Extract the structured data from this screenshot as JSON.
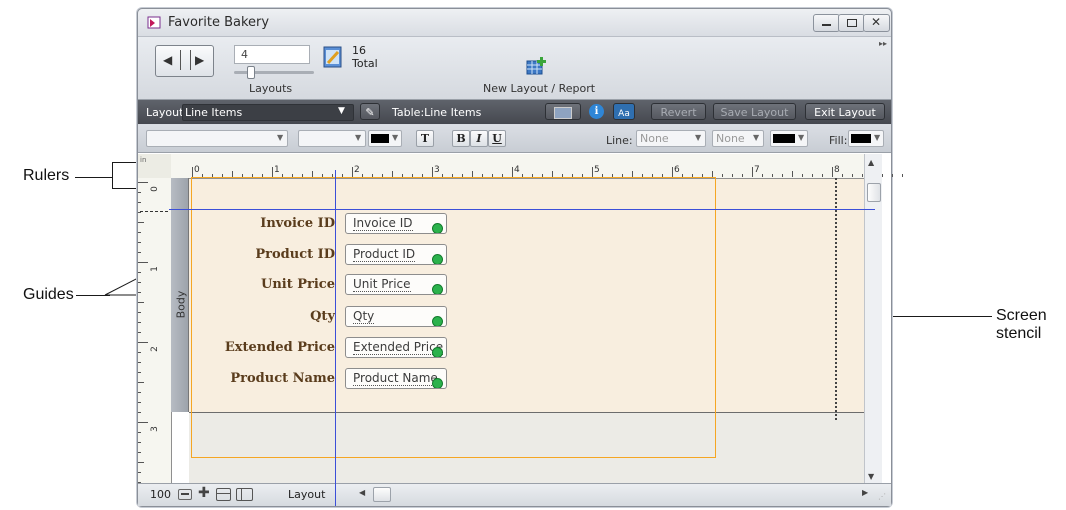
{
  "window": {
    "title": "Favorite Bakery"
  },
  "toolbar": {
    "record_value": "4",
    "layouts_label": "Layouts",
    "total_count": "16",
    "total_label": "Total",
    "new_layout_label": "New Layout / Report"
  },
  "layout_bar": {
    "layout_prefix": "Layout:",
    "layout_name": "Line Items",
    "table_text": "Table:Line Items",
    "revert": "Revert",
    "save_layout": "Save Layout",
    "exit_layout": "Exit Layout",
    "aa": "Aa",
    "info": "i"
  },
  "format_bar": {
    "text_btn": "T",
    "bold": "B",
    "italic": "I",
    "underline": "U",
    "line_label": "Line:",
    "line_value": "None",
    "line_value2": "None",
    "fill_label": "Fill:"
  },
  "ruler": {
    "h_ticks": [
      "0",
      "1",
      "2",
      "3",
      "4",
      "5",
      "6",
      "7",
      "8"
    ],
    "v_ticks": [
      "0",
      "1",
      "2",
      "3"
    ],
    "unit": "in"
  },
  "part_label": "Body",
  "fields": [
    {
      "label": "Invoice ID",
      "field": "Invoice ID"
    },
    {
      "label": "Product ID",
      "field": "Product ID"
    },
    {
      "label": "Unit Price",
      "field": "Unit Price"
    },
    {
      "label": "Qty",
      "field": "Qty"
    },
    {
      "label": "Extended Price",
      "field": "Extended Price"
    },
    {
      "label": "Product Name",
      "field": "Product Name"
    }
  ],
  "bottom_bar": {
    "zoom": "100",
    "mode": "Layout"
  },
  "callouts": {
    "rulers": "Rulers",
    "guides": "Guides",
    "screen_stencil_1": "Screen",
    "screen_stencil_2": "stencil"
  },
  "colors": {
    "guide": "#3b4fd8",
    "stencil": "#f5a623",
    "body_bg": "#f8eedf"
  }
}
